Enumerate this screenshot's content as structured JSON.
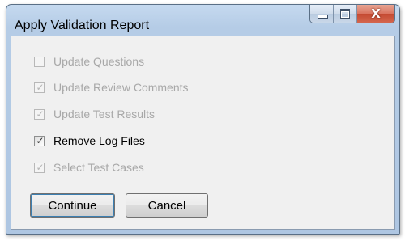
{
  "window": {
    "title": "Apply Validation Report",
    "caption_buttons": [
      {
        "name": "minimize",
        "icon": "minimize-icon"
      },
      {
        "name": "maximize",
        "icon": "maximize-icon"
      },
      {
        "name": "close",
        "icon": "close-icon",
        "glyph": "X"
      }
    ]
  },
  "options": [
    {
      "label": "Update Questions",
      "checked": false,
      "enabled": false
    },
    {
      "label": "Update Review Comments",
      "checked": true,
      "enabled": false
    },
    {
      "label": "Update Test Results",
      "checked": true,
      "enabled": false
    },
    {
      "label": "Remove Log Files",
      "checked": true,
      "enabled": true
    },
    {
      "label": "Select Test Cases",
      "checked": true,
      "enabled": false
    }
  ],
  "buttons": {
    "continue_label": "Continue",
    "cancel_label": "Cancel"
  },
  "colors": {
    "title_bar": "#c5d9ef",
    "client_bg": "#f0f0f0",
    "close_button": "#c44a32",
    "disabled_text": "#a8a8a8"
  }
}
